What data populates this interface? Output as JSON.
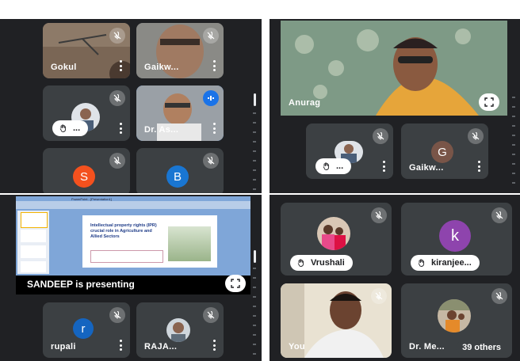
{
  "q1": {
    "tiles": [
      {
        "name": "Gokul"
      },
      {
        "name": "Gaikw..."
      },
      {
        "name": "...",
        "hand": true
      },
      {
        "name": "Dr. As..."
      },
      {
        "avatar_letter": "S",
        "avatar_color": "#f4511e"
      },
      {
        "avatar_letter": "B",
        "avatar_color": "#1976d2"
      }
    ]
  },
  "q2": {
    "main": {
      "name": "Anurag"
    },
    "tiles": [
      {
        "name": "...",
        "hand": true
      },
      {
        "name": "Gaikw...",
        "avatar_letter": "G",
        "avatar_color": "#795548"
      }
    ]
  },
  "q3": {
    "slide": {
      "window_title": "PowerPoint - [Presentation1]",
      "title": "Intellectual property rights (IPR) crucial role in Agriculture and Allied Sectors"
    },
    "presenting_label": "SANDEEP is presenting",
    "tiles": [
      {
        "name": "rupali",
        "avatar_letter": "r",
        "avatar_color": "#1565c0"
      },
      {
        "name": "RAJA..."
      }
    ]
  },
  "q4": {
    "tiles": [
      {
        "name": "Vrushali",
        "hand": true
      },
      {
        "name": "kiranjee...",
        "hand": true,
        "avatar_letter": "k",
        "avatar_color": "#8e44ad"
      },
      {
        "name": "You"
      },
      {
        "name": "Dr. Me...",
        "others_label": "39 others"
      }
    ]
  },
  "colors": {
    "accent": "#1a73e8",
    "tile_bg": "#3c4043",
    "stage_bg": "#202124"
  }
}
